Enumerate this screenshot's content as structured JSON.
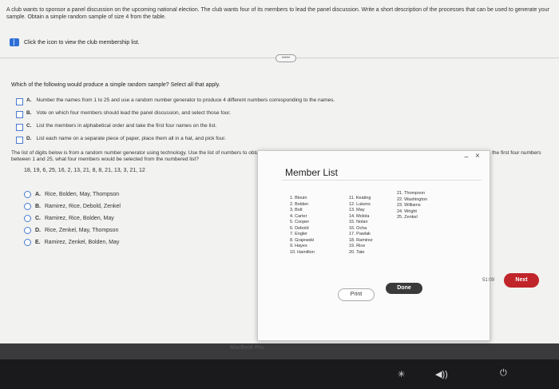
{
  "intro_text": "A club wants to sponsor a panel discussion on the upcoming national election. The club wants four of its members to lead the panel discussion. Write a short description of the processes that can be used to generate your sample. Obtain a simple random sample of size 4 from the table.",
  "member_link_label": "Click the icon to view the club membership list.",
  "question": "Which of the following would produce a simple random sample? Select all that apply.",
  "options": [
    {
      "letter": "A.",
      "text": "Number the names from 1 to 25 and use a random number generator to produce 4 different numbers corresponding to the names."
    },
    {
      "letter": "B.",
      "text": "Vote on which four members should lead the panel discussion, and select those four."
    },
    {
      "letter": "C.",
      "text": "List the members in alphabetical order and take the first four names on the list."
    },
    {
      "letter": "D.",
      "text": "List each name on a separate piece of paper, place them all in a hat, and pick four."
    }
  ],
  "digits_intro": "The list of digits below is from a random number generator using technology. Use the list of numbers to obtain a simple random sample of size 4 from this list. If you start with the first number in the list, and take the first four numbers between 1 and 25, what four members would be selected from the numbered list?",
  "digits": "18, 19, 6, 25, 16, 2, 13, 21, 8, 8, 21, 13, 3, 21, 12",
  "answer_options": [
    {
      "letter": "A.",
      "text": "Rice, Bolden, May, Thompson"
    },
    {
      "letter": "B.",
      "text": "Ramirez, Rice, Debold, Zenkel"
    },
    {
      "letter": "C.",
      "text": "Ramirez, Rice, Bolden, May"
    },
    {
      "letter": "D.",
      "text": "Rice, Zenkel, May, Thompson"
    },
    {
      "letter": "E.",
      "text": "Ramirez, Zenkel, Bolden, May"
    }
  ],
  "modal": {
    "title": "Member List",
    "col1": [
      "1. Blouin",
      "2. Bolden",
      "3. Bolt",
      "4. Carter",
      "5. Cooper",
      "6. Debold",
      "7. Engler",
      "8. Grajewski",
      "9. Hayes",
      "10. Hamilton"
    ],
    "col2": [
      "11. Keating",
      "12. Lukens",
      "13. May",
      "14. Molola",
      "15. Nolan",
      "16. Ocha",
      "17. Pawlak",
      "18. Ramirez",
      "19. Rice",
      "20. Tate"
    ],
    "col3": [
      "21. Thompson",
      "22. Washington",
      "23. Williams",
      "24. Wright",
      "25. Zenkel"
    ],
    "print_label": "Print",
    "done_label": "Done",
    "minimize_glyph": "−",
    "close_glyph": "×"
  },
  "timer": "51:09",
  "next_label": "Next",
  "bezel_label": "MacBook Pro",
  "collapse_label": "•••••",
  "icons": [
    "book-icon",
    "minimize-icon",
    "close-icon",
    "brightness-icon",
    "volume-icon",
    "power-icon"
  ]
}
